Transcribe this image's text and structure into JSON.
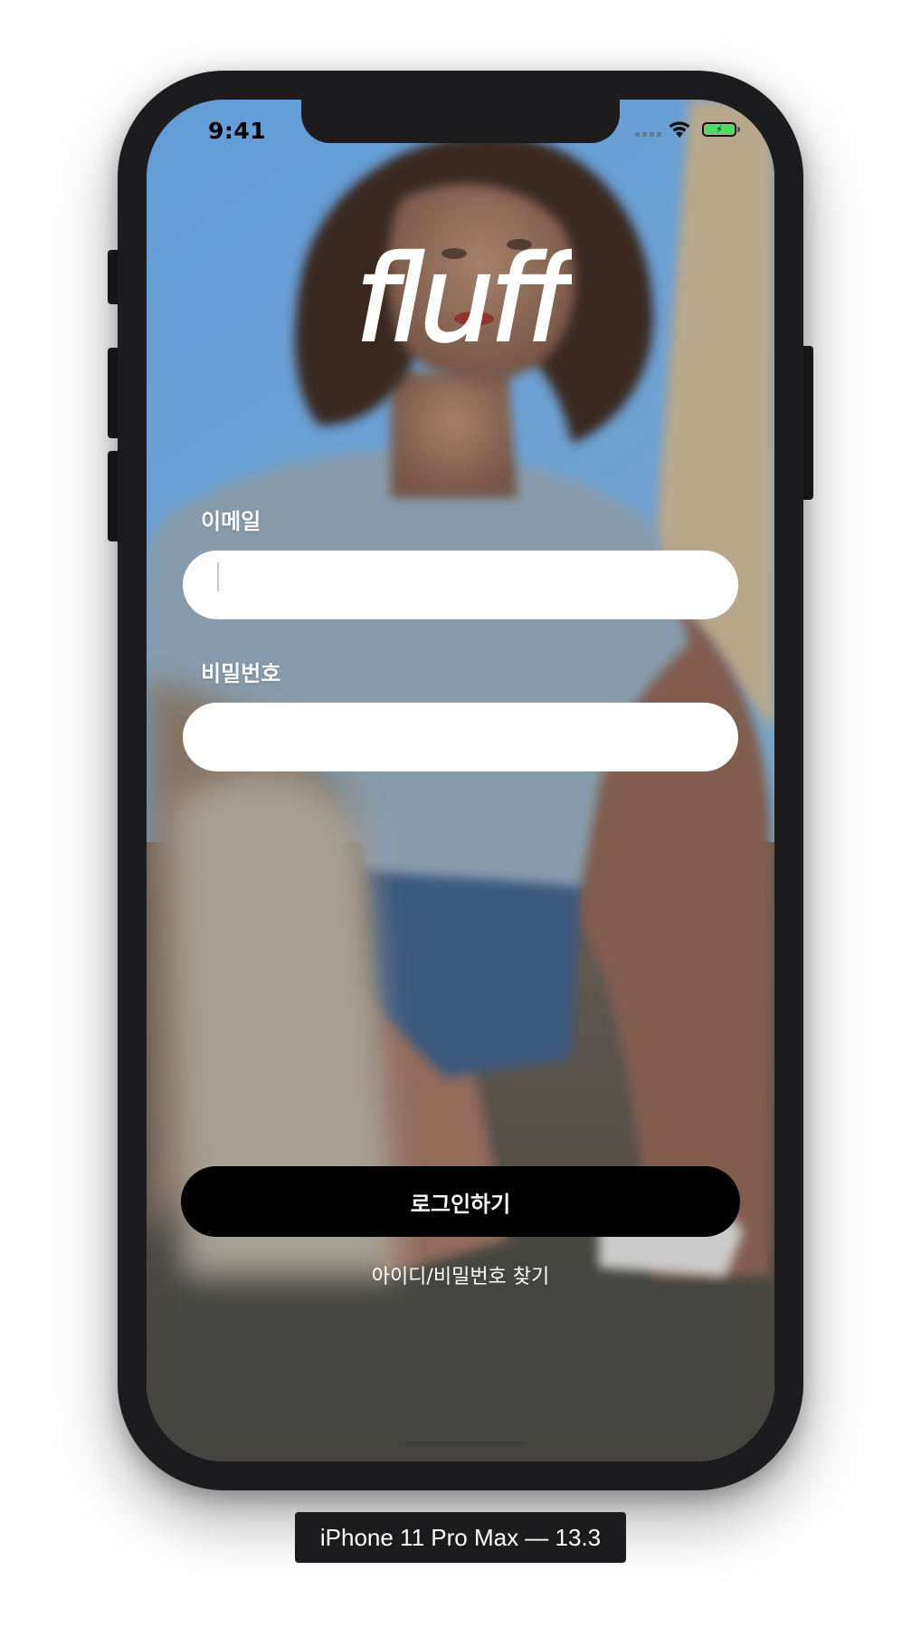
{
  "status_bar": {
    "time": "9:41"
  },
  "app": {
    "logo_text": "fluff"
  },
  "form": {
    "email_label": "이메일",
    "email_value": "",
    "password_label": "비밀번호",
    "password_value": "",
    "login_button": "로그인하기",
    "find_link": "아이디/비밀번호 찾기"
  },
  "simulator": {
    "device_label": "iPhone 11 Pro Max — 13.3"
  },
  "colors": {
    "button_background": "#000000",
    "input_background": "#ffffff",
    "battery_fill": "#4cd964",
    "device_frame": "#1c1c1e"
  },
  "icons": {
    "wifi": "wifi-icon",
    "battery": "battery-charging-icon",
    "signal": "cellular-signal-icon"
  }
}
